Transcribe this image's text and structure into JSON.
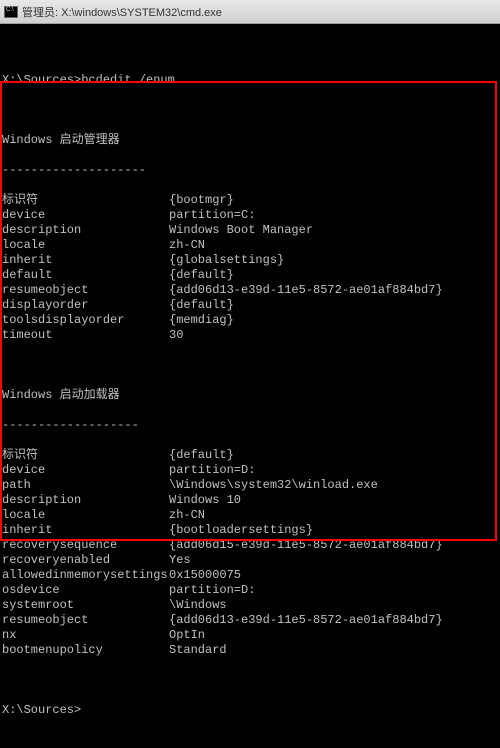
{
  "titlebar": {
    "text": "管理员: X:\\windows\\SYSTEM32\\cmd.exe"
  },
  "prompt1": {
    "path": "X:\\Sources>",
    "command": "bcdedit /enum"
  },
  "section1": {
    "title": "Windows 启动管理器",
    "divider": "--------------------",
    "rows": [
      {
        "k": "标识符",
        "v": "{bootmgr}"
      },
      {
        "k": "device",
        "v": "partition=C:"
      },
      {
        "k": "description",
        "v": "Windows Boot Manager"
      },
      {
        "k": "locale",
        "v": "zh-CN"
      },
      {
        "k": "inherit",
        "v": "{globalsettings}"
      },
      {
        "k": "default",
        "v": "{default}"
      },
      {
        "k": "resumeobject",
        "v": "{add06d13-e39d-11e5-8572-ae01af884bd7}"
      },
      {
        "k": "displayorder",
        "v": "{default}"
      },
      {
        "k": "toolsdisplayorder",
        "v": "{memdiag}"
      },
      {
        "k": "timeout",
        "v": "30"
      }
    ]
  },
  "section2": {
    "title": "Windows 启动加载器",
    "divider": "-------------------",
    "rows": [
      {
        "k": "标识符",
        "v": "{default}"
      },
      {
        "k": "device",
        "v": "partition=D:"
      },
      {
        "k": "path",
        "v": "\\Windows\\system32\\winload.exe"
      },
      {
        "k": "description",
        "v": "Windows 10"
      },
      {
        "k": "locale",
        "v": "zh-CN"
      },
      {
        "k": "inherit",
        "v": "{bootloadersettings}"
      },
      {
        "k": "recoverysequence",
        "v": "{add06d15-e39d-11e5-8572-ae01af884bd7}"
      },
      {
        "k": "recoveryenabled",
        "v": "Yes"
      },
      {
        "k": "allowedinmemorysettings",
        "v": "0x15000075"
      },
      {
        "k": "osdevice",
        "v": "partition=D:"
      },
      {
        "k": "systemroot",
        "v": "\\Windows"
      },
      {
        "k": "resumeobject",
        "v": "{add06d13-e39d-11e5-8572-ae01af884bd7}"
      },
      {
        "k": "nx",
        "v": "OptIn"
      },
      {
        "k": "bootmenupolicy",
        "v": "Standard"
      }
    ]
  },
  "prompt2": {
    "path": "X:\\Sources>",
    "command": ""
  }
}
